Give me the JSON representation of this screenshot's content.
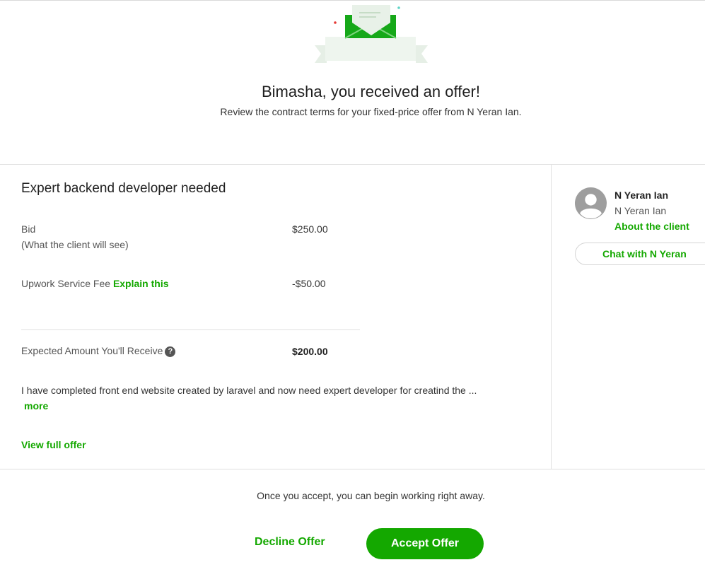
{
  "header": {
    "headline": "Bimasha, you received an offer!",
    "subhead": "Review the contract terms for your fixed-price offer from N Yeran Ian."
  },
  "offer": {
    "title": "Expert backend developer needed",
    "bid_label": "Bid",
    "bid_sublabel": "(What the client will see)",
    "bid_value": "$250.00",
    "fee_label": "Upwork Service Fee",
    "fee_link": "Explain this",
    "fee_value": "-$50.00",
    "expected_label": "Expected Amount You'll Receive",
    "expected_value": "$200.00",
    "description": "I have completed front end website created by laravel and now need expert developer for creatind the ...",
    "more_link": "more",
    "view_full_link": "View full offer"
  },
  "client": {
    "name": "N Yeran Ian",
    "subname": "N Yeran Ian",
    "about_link": "About the client",
    "chat_button": "Chat with N Yeran"
  },
  "footer": {
    "note": "Once you accept, you can begin working right away.",
    "decline": "Decline Offer",
    "accept": "Accept Offer"
  },
  "colors": {
    "accent": "#14a800",
    "illustration_light": "#e6f2e6"
  },
  "icons": {
    "envelope": "envelope-offer-illustration",
    "avatar": "user-avatar-icon",
    "help": "question-circle-icon"
  }
}
